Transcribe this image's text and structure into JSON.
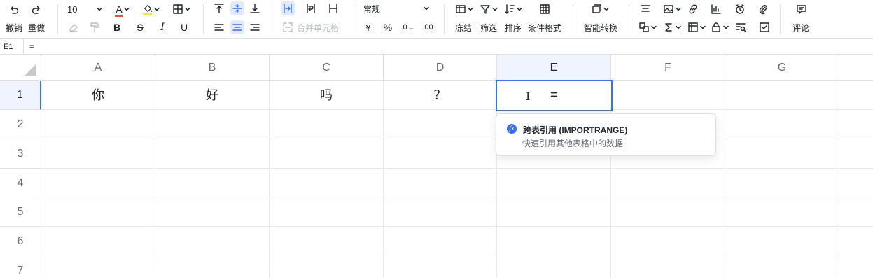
{
  "toolbar": {
    "undo_label": "撤销",
    "redo_label": "重做",
    "font_size": "10",
    "font_color_letter": "A",
    "bold": "B",
    "strike": "S",
    "italic": "I",
    "underline": "U",
    "number_format": "常规",
    "merge_label": "合并单元格",
    "currency": "¥",
    "percent": "%",
    "dec_decrease": ".0",
    "dec_increase": ".00",
    "freeze_label": "冻结",
    "filter_label": "筛选",
    "sort_label": "排序",
    "cond_format_label": "条件格式",
    "smart_convert_label": "智能转换",
    "comment_label": "评论",
    "accent_color": "#3370ff",
    "font_color_bar": "#f54a45",
    "fill_color_bar": "#ffe928"
  },
  "formula_bar": {
    "cell_ref": "E1",
    "formula": "="
  },
  "grid": {
    "columns": [
      "A",
      "B",
      "C",
      "D",
      "E",
      "F",
      "G"
    ],
    "rows": [
      "1",
      "2",
      "3",
      "4",
      "5",
      "6",
      "7"
    ],
    "row1": [
      "你",
      "好",
      "吗",
      "？"
    ],
    "active_cell_value": "="
  },
  "suggestion": {
    "icon_label": "fx",
    "title": "跨表引用 (IMPORTRANGE)",
    "desc": "快速引用其他表格中的数据"
  }
}
